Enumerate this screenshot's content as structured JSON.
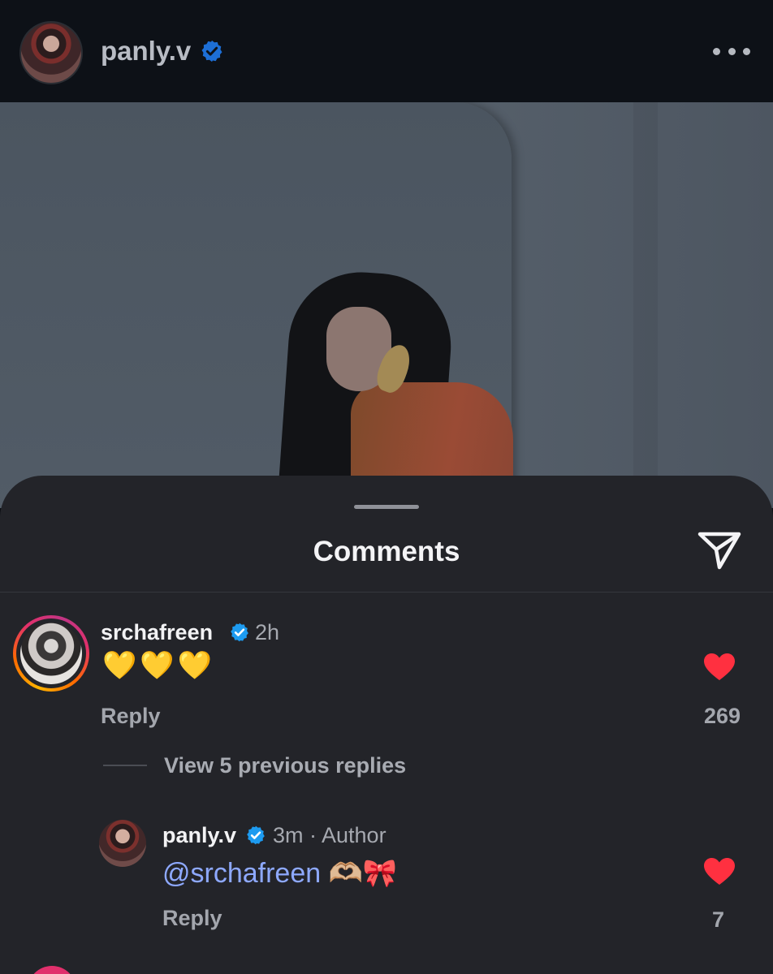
{
  "header": {
    "username": "panly.v",
    "verified": true,
    "more_icon": "more-horizontal-icon"
  },
  "post": {
    "media": "photo"
  },
  "comments_sheet": {
    "title": "Comments",
    "share_icon": "send-icon",
    "comments": [
      {
        "username": "srchafreen",
        "verified": true,
        "time": "2h",
        "text": "💛💛💛",
        "reply_label": "Reply",
        "like_count": "269",
        "liked": true,
        "view_replies_label": "View 5 previous replies"
      },
      {
        "username": "panly.v",
        "verified": true,
        "time": "3m · Author",
        "mention": "@srchafreen",
        "text": " 🫶🏼🎀",
        "reply_label": "Reply",
        "like_count": "7",
        "liked": true
      }
    ]
  },
  "colors": {
    "background": "#0b0e13",
    "sheet": "#232429",
    "verified_blue": "#1d9bf0",
    "like_red": "#ff3040",
    "mention": "#8ea9ff",
    "muted_text": "#a3a6ad"
  }
}
